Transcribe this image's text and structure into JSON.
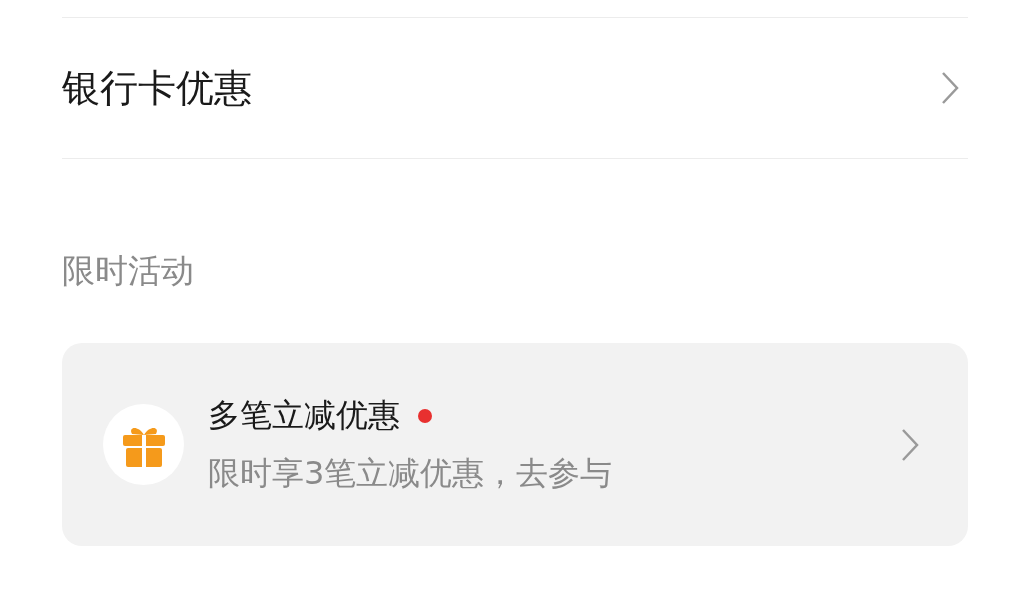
{
  "bank_card_row": {
    "label": "银行卡优惠"
  },
  "section_title": "限时活动",
  "activity": {
    "title": "多笔立减优惠",
    "unread": true,
    "subtitle": "限时享3笔立减优惠，去参与"
  }
}
